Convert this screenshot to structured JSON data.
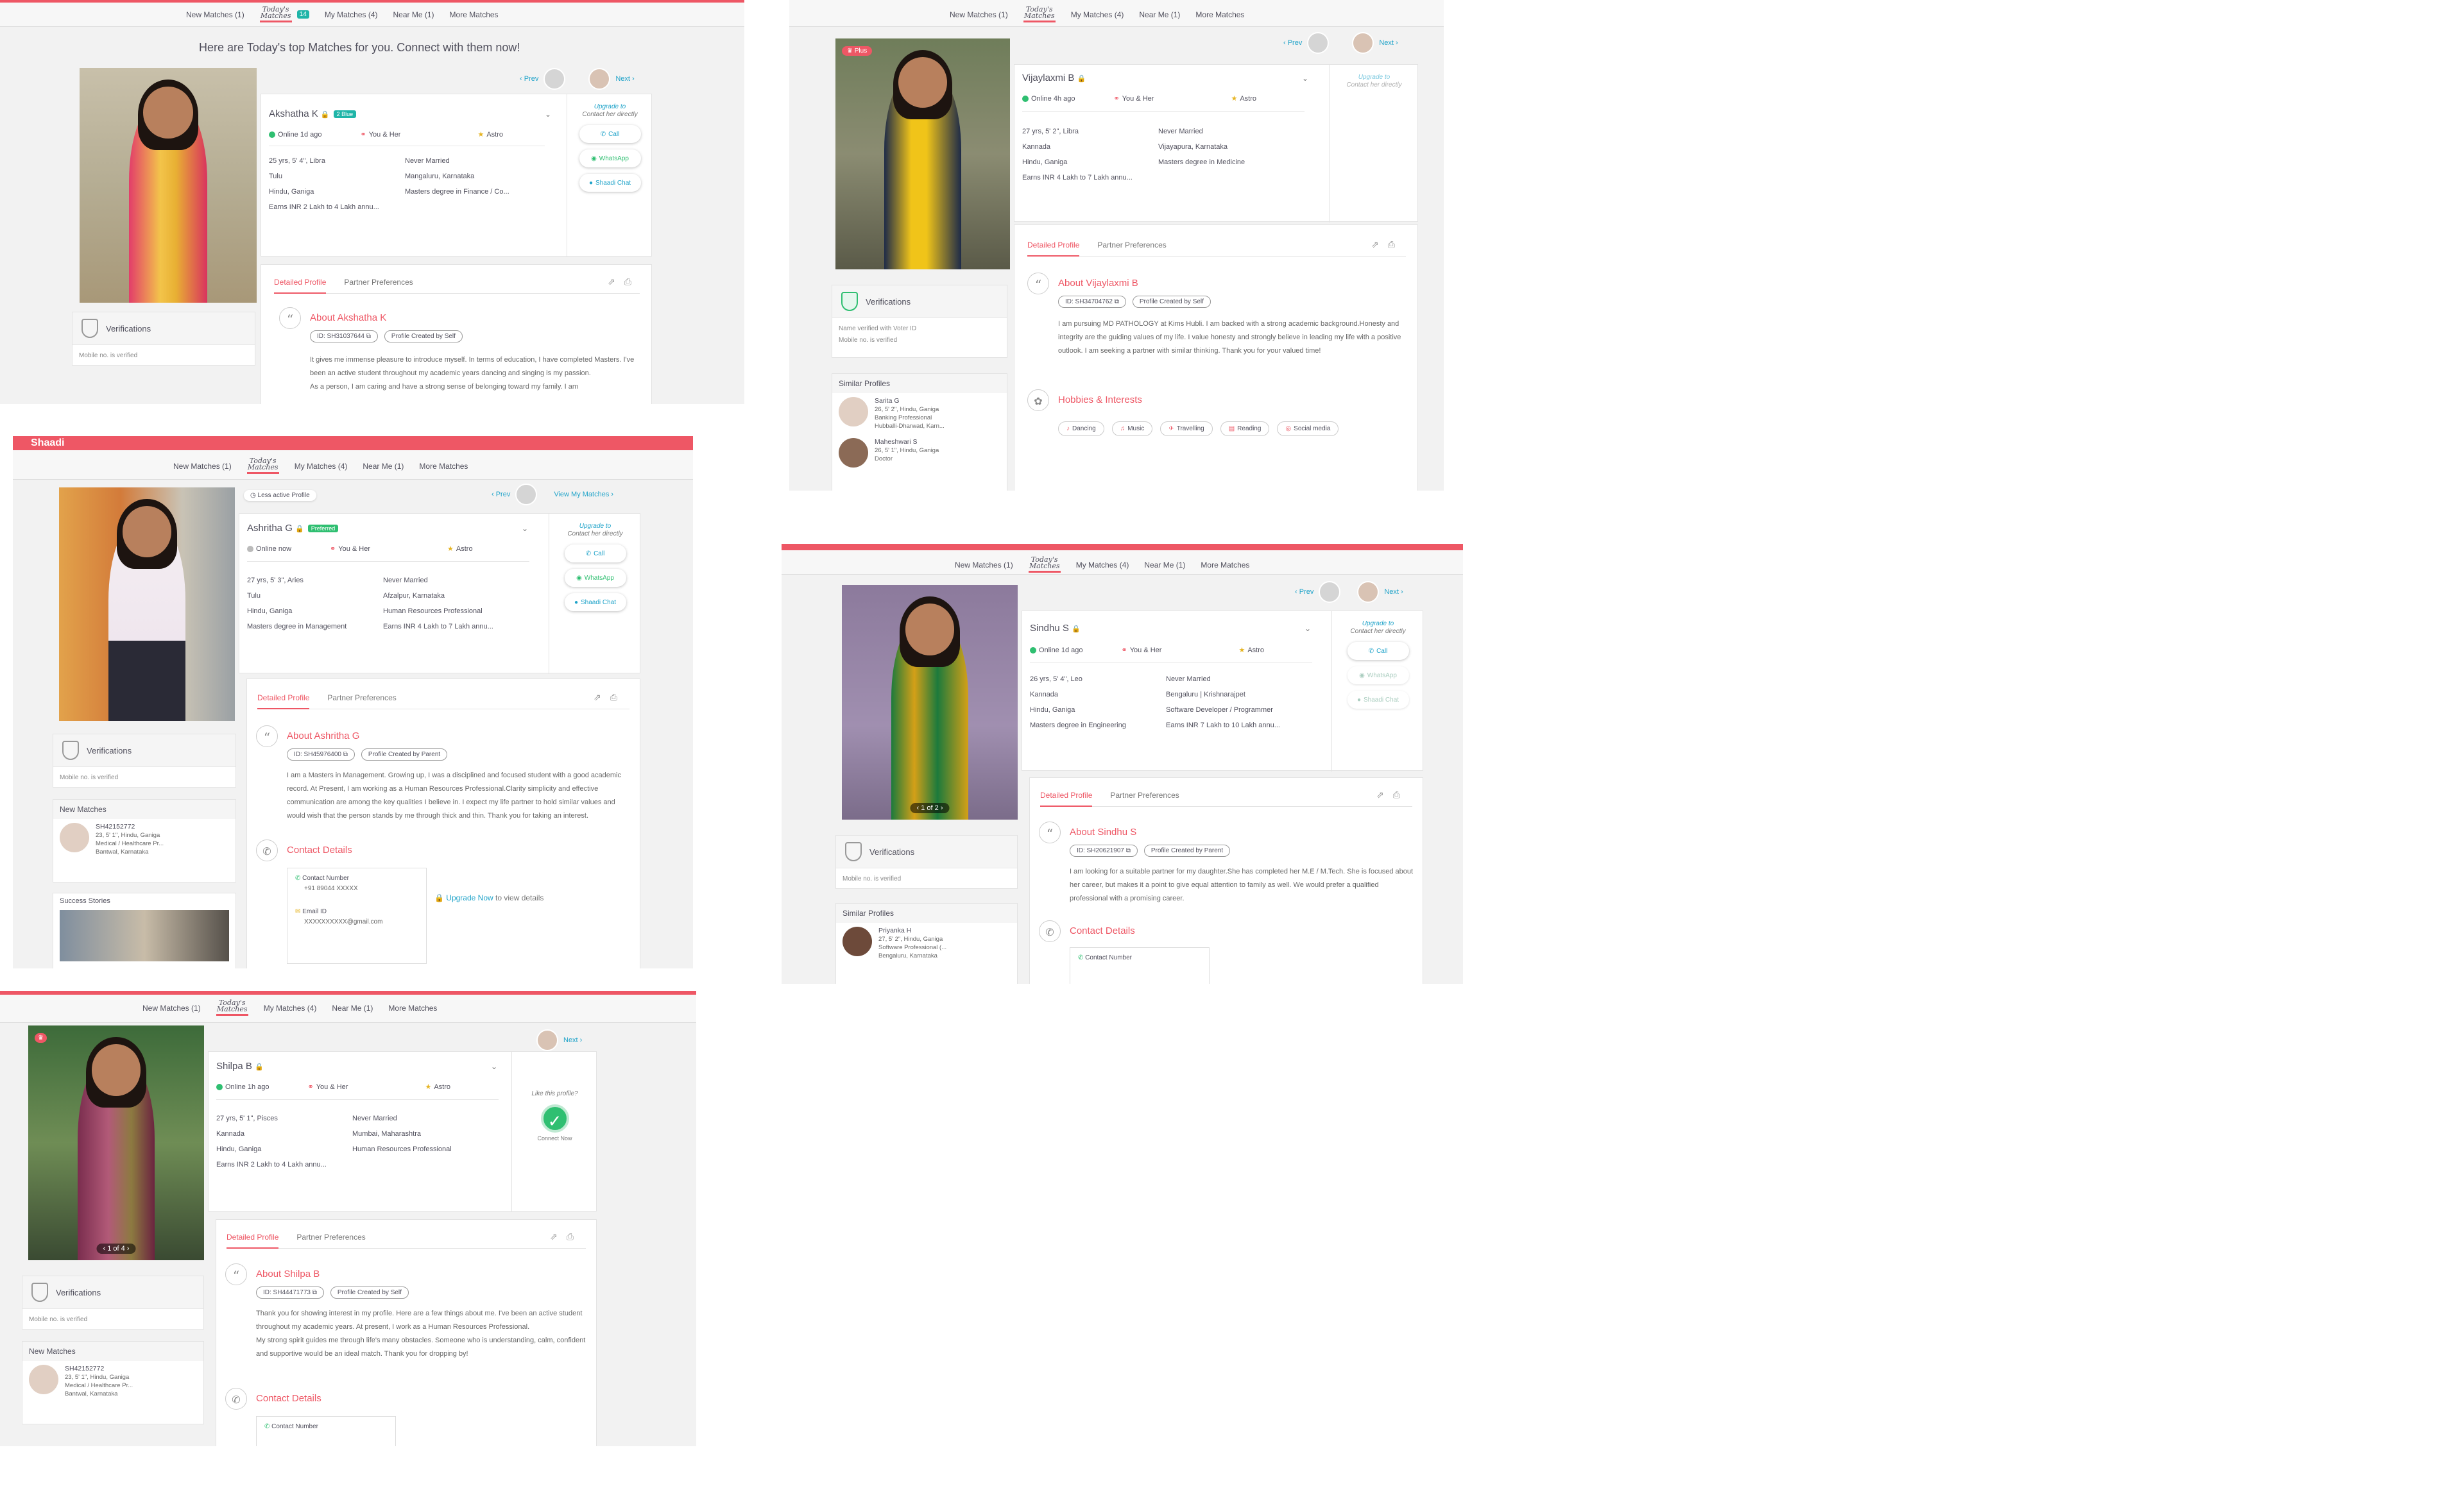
{
  "nav": {
    "new_matches": "New Matches (1)",
    "today_top": "Today's",
    "today_bottom": "Matches",
    "today_count": "14",
    "my_matches": "My Matches (4)",
    "near_me": "Near Me (1)",
    "more_matches": "More Matches",
    "brand": "Shaadi"
  },
  "common": {
    "prev": "‹ Prev",
    "next": "Next ›",
    "you_her": "You & Her",
    "astro": "Astro",
    "upgrade_to": "Upgrade to",
    "contact_directly": "Contact her directly",
    "call": "Call",
    "whatsapp": "WhatsApp",
    "shaadi_chat": "Shaadi Chat",
    "detailed_profile": "Detailed Profile",
    "partner_prefs": "Partner Preferences",
    "verifications": "Verifications",
    "mobile_verified": "Mobile no. is verified",
    "contact_details": "Contact Details",
    "similar_profiles": "Similar Profiles",
    "new_matches_title": "New Matches",
    "success_stories": "Success Stories",
    "created_self": "Profile Created by Self",
    "created_parent": "Profile Created by Parent",
    "contact_number": "Contact Number",
    "email_id": "Email ID"
  },
  "panel1": {
    "headline": "Here are Today's top Matches for you. Connect with them now!",
    "name": "Akshatha K",
    "badge": "2 Blue",
    "online": "Online 1d ago",
    "left": [
      "25 yrs, 5' 4\", Libra",
      "Tulu",
      "Hindu, Ganiga",
      "Earns INR 2 Lakh to 4 Lakh annu..."
    ],
    "right": [
      "Never Married",
      "Mangaluru, Karnataka",
      "Masters degree in Finance / Co..."
    ],
    "about_title": "About Akshatha K",
    "id": "ID: SH31037644",
    "about": "It gives me immense pleasure to introduce myself. In terms of education, I have completed Masters. I've been an active student throughout my academic years dancing and singing is my passion.",
    "about2": "As a person, I am caring and have a strong sense of belonging toward my family. I am"
  },
  "panel2": {
    "name": "Vijaylaxmi B",
    "online": "Online 4h ago",
    "left": [
      "27 yrs, 5' 2\", Libra",
      "Kannada",
      "Hindu, Ganiga",
      "Earns INR 4 Lakh to 7 Lakh annu..."
    ],
    "right": [
      "Never Married",
      "Vijayapura, Karnataka",
      "Masters degree in Medicine"
    ],
    "about_title": "About Vijaylaxmi B",
    "id": "ID: SH34704762",
    "about": "I am pursuing MD PATHOLOGY at Kims Hubli. I am backed with a strong academic background.Honesty and integrity are the guiding values of my life. I value honesty and strongly believe in leading my life with a positive outlook. I am seeking a partner with similar thinking. Thank you for your valued time!",
    "hobbies_title": "Hobbies & Interests",
    "hobbies": [
      "Dancing",
      "Music",
      "Travelling",
      "Reading",
      "Social media"
    ],
    "verified_voter": "Name verified with Voter ID",
    "plus": "Plus",
    "similar": [
      {
        "name": "Sarita G",
        "l1": "26, 5' 2\", Hindu, Ganiga",
        "l2": "Banking Professional",
        "l3": "Hubballi-Dharwad, Karn..."
      },
      {
        "name": "Maheshwari S",
        "l1": "26, 5' 1\", Hindu, Ganiga",
        "l2": "Doctor",
        "l3": ""
      }
    ]
  },
  "panel3": {
    "less_active": "Less active Profile",
    "view_my": "View My Matches ›",
    "name": "Ashritha G",
    "badge": "Preferred",
    "online": "Online now",
    "left": [
      "27 yrs, 5' 3\", Aries",
      "Tulu",
      "Hindu, Ganiga",
      "Masters degree in Management"
    ],
    "right": [
      "Never Married",
      "Afzalpur, Karnataka",
      "Human Resources Professional",
      "Earns INR 4 Lakh to 7 Lakh annu..."
    ],
    "about_title": "About Ashritha G",
    "id": "ID: SH45976400",
    "about": "I am a Masters in Management. Growing up, I was a disciplined and focused student with a good academic record. At Present, I am working as a Human Resources Professional.Clarity simplicity and effective communication are among the key qualities I believe in. I expect my life partner to hold similar values and would wish that the person stands by me through thick and thin. Thank you for taking an interest.",
    "phone": "+91 89044 XXXXX",
    "email": "XXXXXXXXXX@gmail.com",
    "upgrade_now": "Upgrade Now",
    "to_view": "to view details",
    "newmatch": {
      "id": "SH42152772",
      "l1": "23, 5' 1\", Hindu, Ganiga",
      "l2": "Medical / Healthcare Pr...",
      "l3": "Bantwal, Karnataka"
    }
  },
  "panel4": {
    "name": "Sindhu S",
    "online": "Online 1d ago",
    "left": [
      "26 yrs, 5' 4\", Leo",
      "Kannada",
      "Hindu, Ganiga",
      "Masters degree in Engineering"
    ],
    "right": [
      "Never Married",
      "Bengaluru | Krishnarajpet",
      "Software Developer / Programmer",
      "Earns INR 7 Lakh to 10 Lakh annu..."
    ],
    "about_title": "About Sindhu S",
    "id": "ID: SH20621907",
    "about": "I am looking for a suitable partner for my daughter.She has completed her M.E / M.Tech. She is focused about her career, but makes it a point to give equal attention to family as well. We would prefer a qualified professional with a promising career.",
    "carousel": "1 of 2",
    "similar": {
      "name": "Priyanka H",
      "l1": "27, 5' 2\", Hindu, Ganiga",
      "l2": "Software Professional (...",
      "l3": "Bengaluru, Karnataka"
    }
  },
  "panel5": {
    "name": "Shilpa B",
    "online": "Online 1h ago",
    "left": [
      "27 yrs, 5' 1\", Pisces",
      "Kannada",
      "Hindu, Ganiga",
      "Earns INR 2 Lakh to 4 Lakh annu..."
    ],
    "right": [
      "Never Married",
      "Mumbai, Maharashtra",
      "Human Resources Professional"
    ],
    "about_title": "About Shilpa B",
    "id": "ID: SH44471773",
    "about": "Thank you for showing interest in my profile. Here are a few things about me. I've been an active student throughout my academic years. At present, I work as a Human Resources Professional.",
    "about2": "My strong spirit guides me through life's many obstacles. Someone who is understanding, calm, confident and supportive would be an ideal match. Thank you for dropping by!",
    "like": "Like this profile?",
    "connect": "Connect Now",
    "carousel": "1 of 4",
    "newmatch": {
      "id": "SH42152772",
      "l1": "23, 5' 1\", Hindu, Ganiga",
      "l2": "Medical / Healthcare Pr...",
      "l3": "Bantwal, Karnataka"
    }
  },
  "colors": {
    "accent": "#ee5765",
    "link": "#1fa3c9",
    "online": "#2fbf71"
  }
}
